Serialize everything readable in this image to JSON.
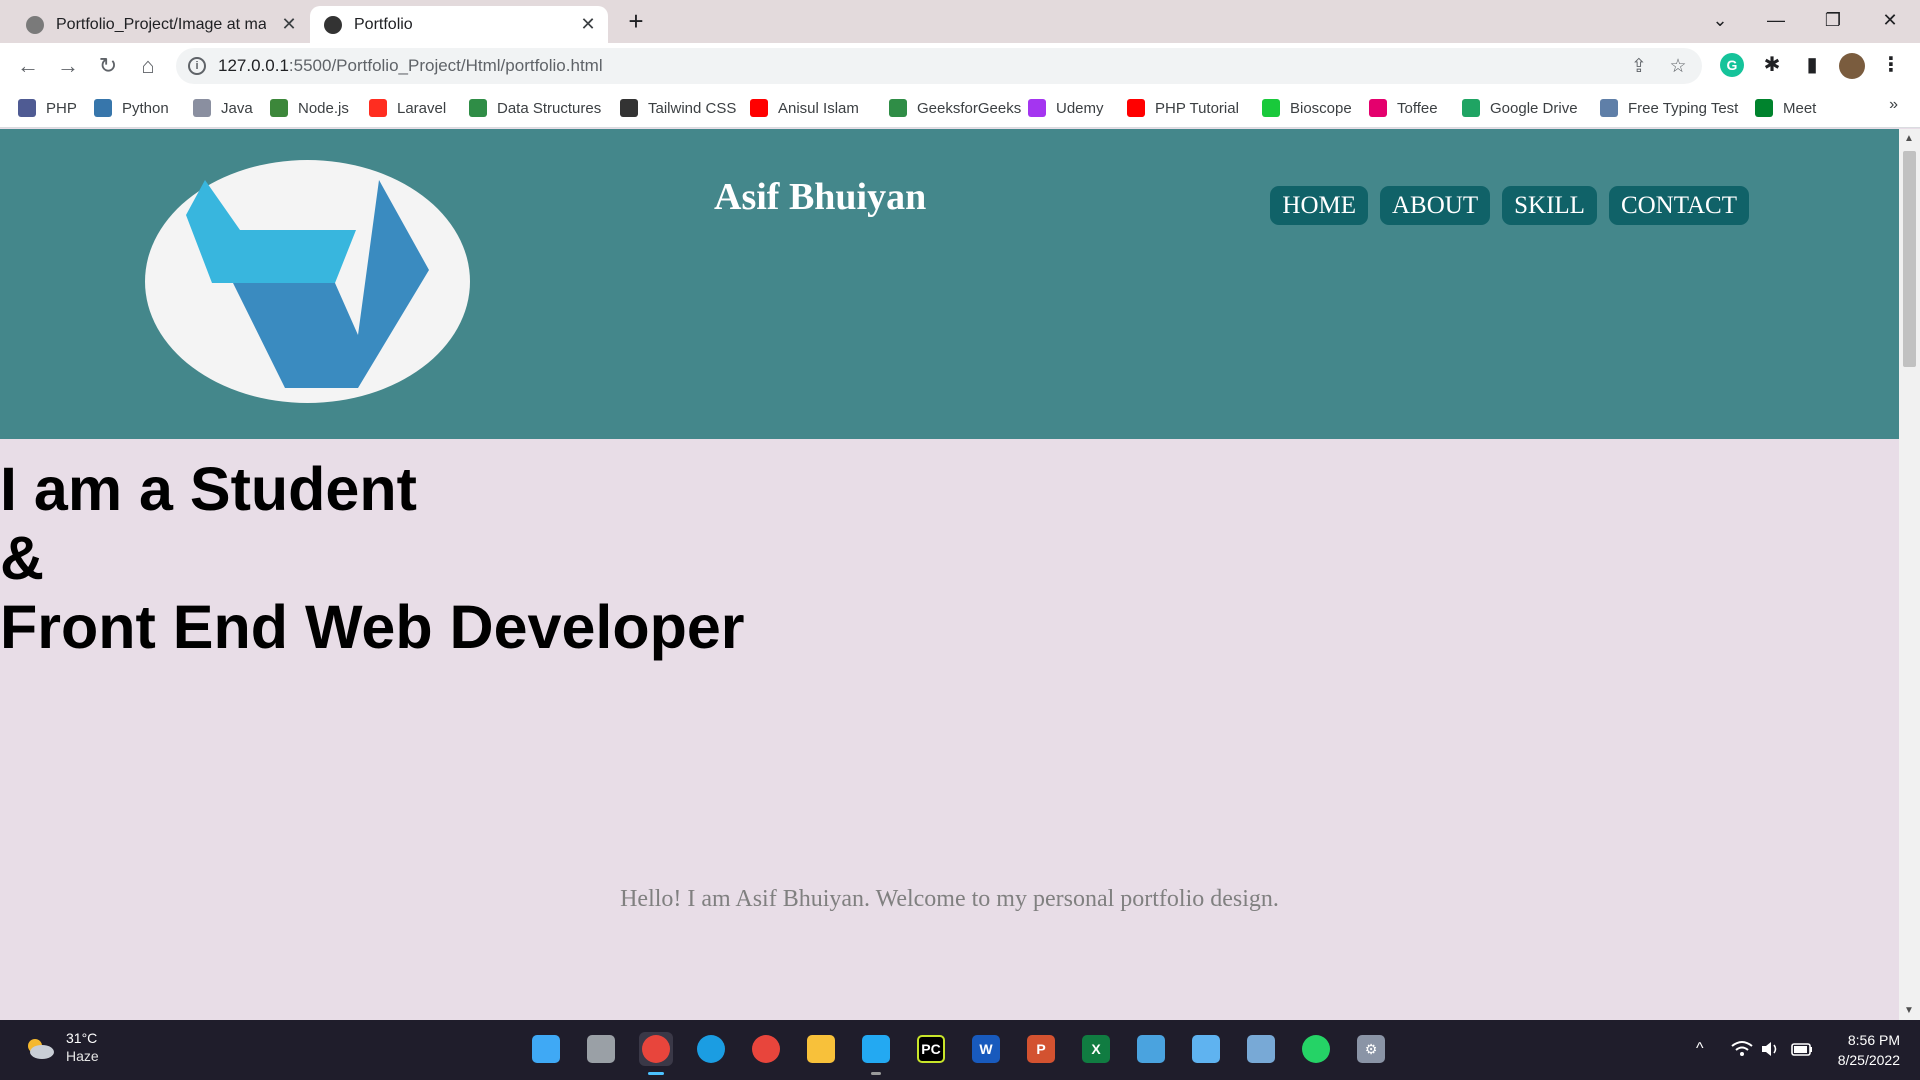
{
  "browser": {
    "tabs": [
      {
        "label": "Portfolio_Project/Image at main · ",
        "icon": "github-icon",
        "active": false
      },
      {
        "label": "Portfolio",
        "icon": "globe-icon",
        "active": true
      }
    ],
    "new_tab_label": "+",
    "window_controls": {
      "minimize": "—",
      "restore": "❐",
      "close": "✕",
      "tab_search": "⌄"
    },
    "url_host": "127.0.0.1",
    "url_path": ":5500/Portfolio_Project/Html/portfolio.html",
    "nav": {
      "back": "←",
      "forward": "→",
      "reload": "↻",
      "home": "⌂"
    },
    "omnibox_actions": {
      "share": "⇪",
      "bookmark": "☆"
    },
    "extensions": [
      {
        "name": "grammarly-icon",
        "glyph": "G",
        "color": "#15c39a"
      },
      {
        "name": "extensions-puzzle-icon",
        "glyph": "✱",
        "color": "#202124"
      },
      {
        "name": "side-panel-icon",
        "glyph": "▮",
        "color": "#202124"
      },
      {
        "name": "profile-avatar",
        "glyph": "",
        "color": "#7a5c3e"
      },
      {
        "name": "menu-kebab-icon",
        "glyph": "⋮",
        "color": "#202124"
      }
    ]
  },
  "bookmarks": [
    {
      "label": "PHP",
      "color": "#4f5b93"
    },
    {
      "label": "Python",
      "color": "#3776ab"
    },
    {
      "label": "Java",
      "color": "#8a8fa0"
    },
    {
      "label": "Node.js",
      "color": "#3c873a"
    },
    {
      "label": "Laravel",
      "color": "#ff2d20"
    },
    {
      "label": "Data Structures",
      "color": "#2f8d46"
    },
    {
      "label": "Tailwind CSS",
      "color": "#333333"
    },
    {
      "label": "Anisul Islam",
      "color": "#ff0000"
    },
    {
      "label": "GeeksforGeeks",
      "color": "#2f8d46"
    },
    {
      "label": "Udemy",
      "color": "#a435f0"
    },
    {
      "label": "PHP Tutorial",
      "color": "#ff0000"
    },
    {
      "label": "Bioscope",
      "color": "#19c93b"
    },
    {
      "label": "Toffee",
      "color": "#e4006d"
    },
    {
      "label": "Google Drive",
      "color": "#1fa463"
    },
    {
      "label": "Free Typing Test",
      "color": "#5f7fa8"
    },
    {
      "label": "Meet",
      "color": "#00832d"
    }
  ],
  "bookmarks_more": "»",
  "site": {
    "name": "Asif Bhuiyan",
    "nav": [
      "HOME",
      "ABOUT",
      "SKILL",
      "CONTACT"
    ],
    "header_color": "#44878b",
    "nav_button_color": "#106268",
    "hero_line1": "I am a Student",
    "hero_line2": "&",
    "hero_line3": "Front End Web Developer",
    "hero_subtitle": "Hello! I am Asif Bhuiyan. Welcome to my personal portfolio design."
  },
  "taskbar": {
    "weather_temp": "31°C",
    "weather_condition": "Haze",
    "apps": [
      {
        "name": "start-windows-icon",
        "glyph": "",
        "color": "#3fa9f5"
      },
      {
        "name": "task-view-icon",
        "glyph": "",
        "color": "#9aa0a6"
      },
      {
        "name": "chrome-profile-icon",
        "glyph": "",
        "color": "#e8453c"
      },
      {
        "name": "edge-icon",
        "glyph": "",
        "color": "#1b9de2"
      },
      {
        "name": "chrome-icon",
        "glyph": "",
        "color": "#e8453c"
      },
      {
        "name": "file-explorer-icon",
        "glyph": "",
        "color": "#f8c13a"
      },
      {
        "name": "vscode-icon",
        "glyph": "",
        "color": "#23a9f2"
      },
      {
        "name": "pycharm-icon",
        "glyph": "PC",
        "color": "#000000"
      },
      {
        "name": "word-icon",
        "glyph": "W",
        "color": "#185abd"
      },
      {
        "name": "powerpoint-icon",
        "glyph": "P",
        "color": "#d35230"
      },
      {
        "name": "excel-icon",
        "glyph": "X",
        "color": "#107c41"
      },
      {
        "name": "control-panel-icon",
        "glyph": "",
        "color": "#4aa3df"
      },
      {
        "name": "notepad-icon",
        "glyph": "",
        "color": "#5fb3f0"
      },
      {
        "name": "photos-icon",
        "glyph": "",
        "color": "#78a9d6"
      },
      {
        "name": "whatsapp-icon",
        "glyph": "",
        "color": "#25d366"
      },
      {
        "name": "settings-gear-icon",
        "glyph": "⚙",
        "color": "#8a94a6"
      }
    ],
    "tray": {
      "overflow": "^",
      "wifi": "wifi",
      "volume": "vol",
      "battery": "bat"
    },
    "time": "8:56 PM",
    "date": "8/25/2022"
  }
}
